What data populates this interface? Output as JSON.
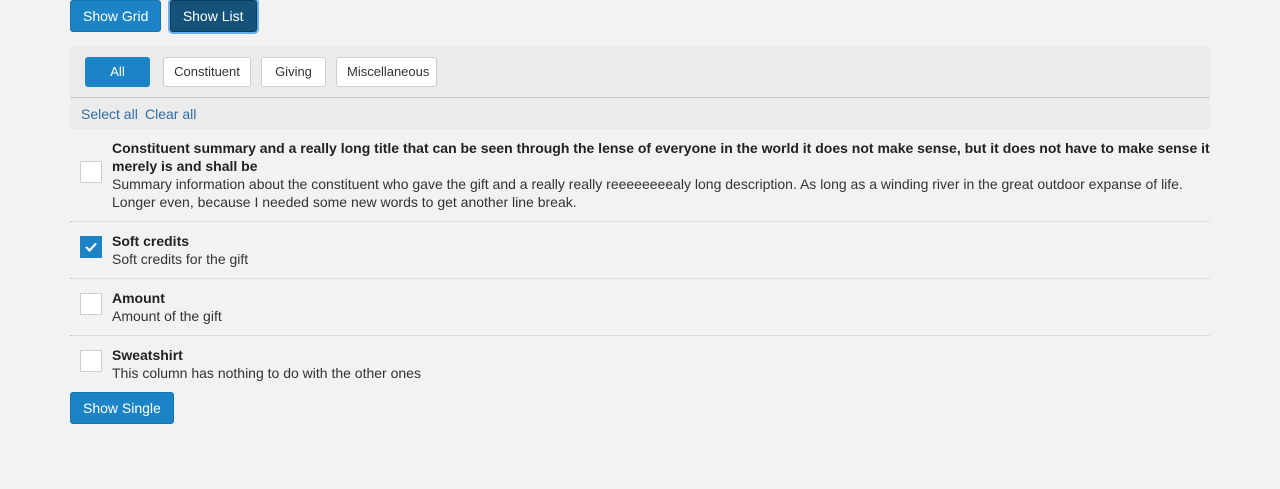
{
  "top_buttons": {
    "grid": "Show Grid",
    "list": "Show List"
  },
  "filters": {
    "all": "All",
    "constituent": "Constituent",
    "giving": "Giving",
    "misc": "Miscellaneous"
  },
  "links": {
    "select_all": "Select all",
    "clear_all": "Clear all"
  },
  "items": [
    {
      "title": "Constituent summary and a really long title that can be seen through the lense of everyone in the world it does not make sense, but it does not have to make sense it merely is and shall be",
      "description": "Summary information about the constituent who gave the gift and a really really reeeeeeeealy long description. As long as a winding river in the great outdoor expanse of life. Longer even, because I needed some new words to get another line break.",
      "checked": false
    },
    {
      "title": "Soft credits",
      "description": "Soft credits for the gift",
      "checked": true
    },
    {
      "title": "Amount",
      "description": "Amount of the gift",
      "checked": false
    },
    {
      "title": "Sweatshirt",
      "description": "This column has nothing to do with the other ones",
      "checked": false
    }
  ],
  "bottom_button": "Show Single",
  "colors": {
    "primary": "#1c84c6",
    "primary_dark": "#14527a",
    "link": "#2e6da4",
    "background": "#f2f2f2"
  }
}
